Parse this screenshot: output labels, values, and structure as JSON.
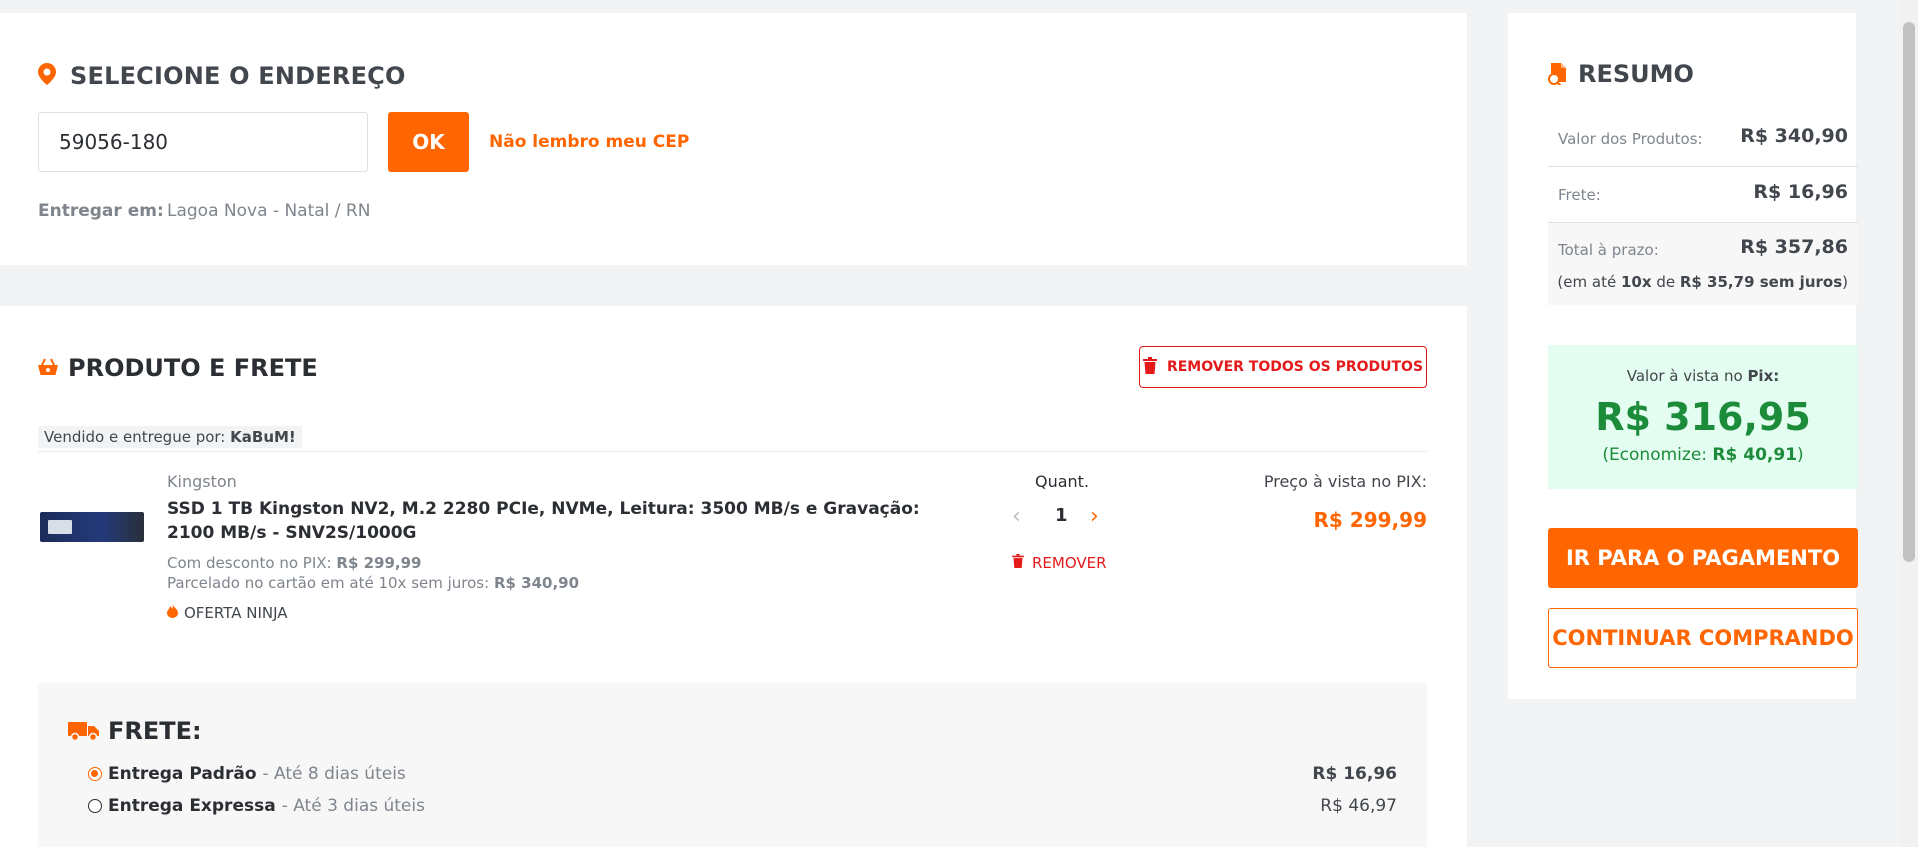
{
  "address": {
    "title": "SELECIONE O ENDEREÇO",
    "cep_value": "59056-180",
    "ok_label": "OK",
    "forgot_cep": "Não lembro meu CEP",
    "deliver_label": "Entregar em:",
    "deliver_value": "Lagoa Nova - Natal / RN"
  },
  "product_section": {
    "title": "PRODUTO E FRETE",
    "remove_all_label": "REMOVER TODOS OS PRODUTOS",
    "seller_prefix": "Vendido e entregue por:",
    "seller_name": "KaBuM!",
    "item": {
      "brand": "Kingston",
      "name": "SSD 1 TB Kingston NV2, M.2 2280 PCIe, NVMe, Leitura: 3500 MB/s e Gravação: 2100 MB/s - SNV2S/1000G",
      "pix_discount_label": "Com desconto no PIX:",
      "pix_discount_value": "R$ 299,99",
      "installment_label": "Parcelado no cartão em até 10x sem juros:",
      "installment_value": "R$ 340,90",
      "badge": "OFERTA NINJA",
      "quantity_label": "Quant.",
      "quantity": "1",
      "remove_label": "REMOVER",
      "price_label": "Preço à vista no PIX:",
      "price": "R$ 299,99"
    }
  },
  "shipping": {
    "title": "FRETE:",
    "options": [
      {
        "name": "Entrega Padrão",
        "eta": "- Até 8 dias úteis",
        "price": "R$ 16,96",
        "selected": true
      },
      {
        "name": "Entrega Expressa",
        "eta": "- Até 3 dias úteis",
        "price": "R$ 46,97",
        "selected": false
      }
    ]
  },
  "summary": {
    "title": "RESUMO",
    "products_label": "Valor dos Produtos:",
    "products_value": "R$ 340,90",
    "shipping_label": "Frete:",
    "shipping_value": "R$ 16,96",
    "total_label": "Total à prazo:",
    "total_value": "R$ 357,86",
    "installments_prefix": "(em até",
    "installments_count": "10x",
    "installments_mid": "de",
    "installments_value": "R$ 35,79 sem juros",
    "installments_suffix": ")",
    "pix_label": "Valor à vista no",
    "pix_word": "Pix:",
    "pix_value": "R$ 316,95",
    "economy_prefix": "(Economize:",
    "economy_value": "R$ 40,91",
    "economy_suffix": ")",
    "pay_label": "IR PARA O PAGAMENTO",
    "continue_label": "CONTINUAR COMPRANDO"
  },
  "colors": {
    "accent": "#ff6500",
    "danger": "#e41a1a",
    "pix_green": "#1d8c3a"
  }
}
